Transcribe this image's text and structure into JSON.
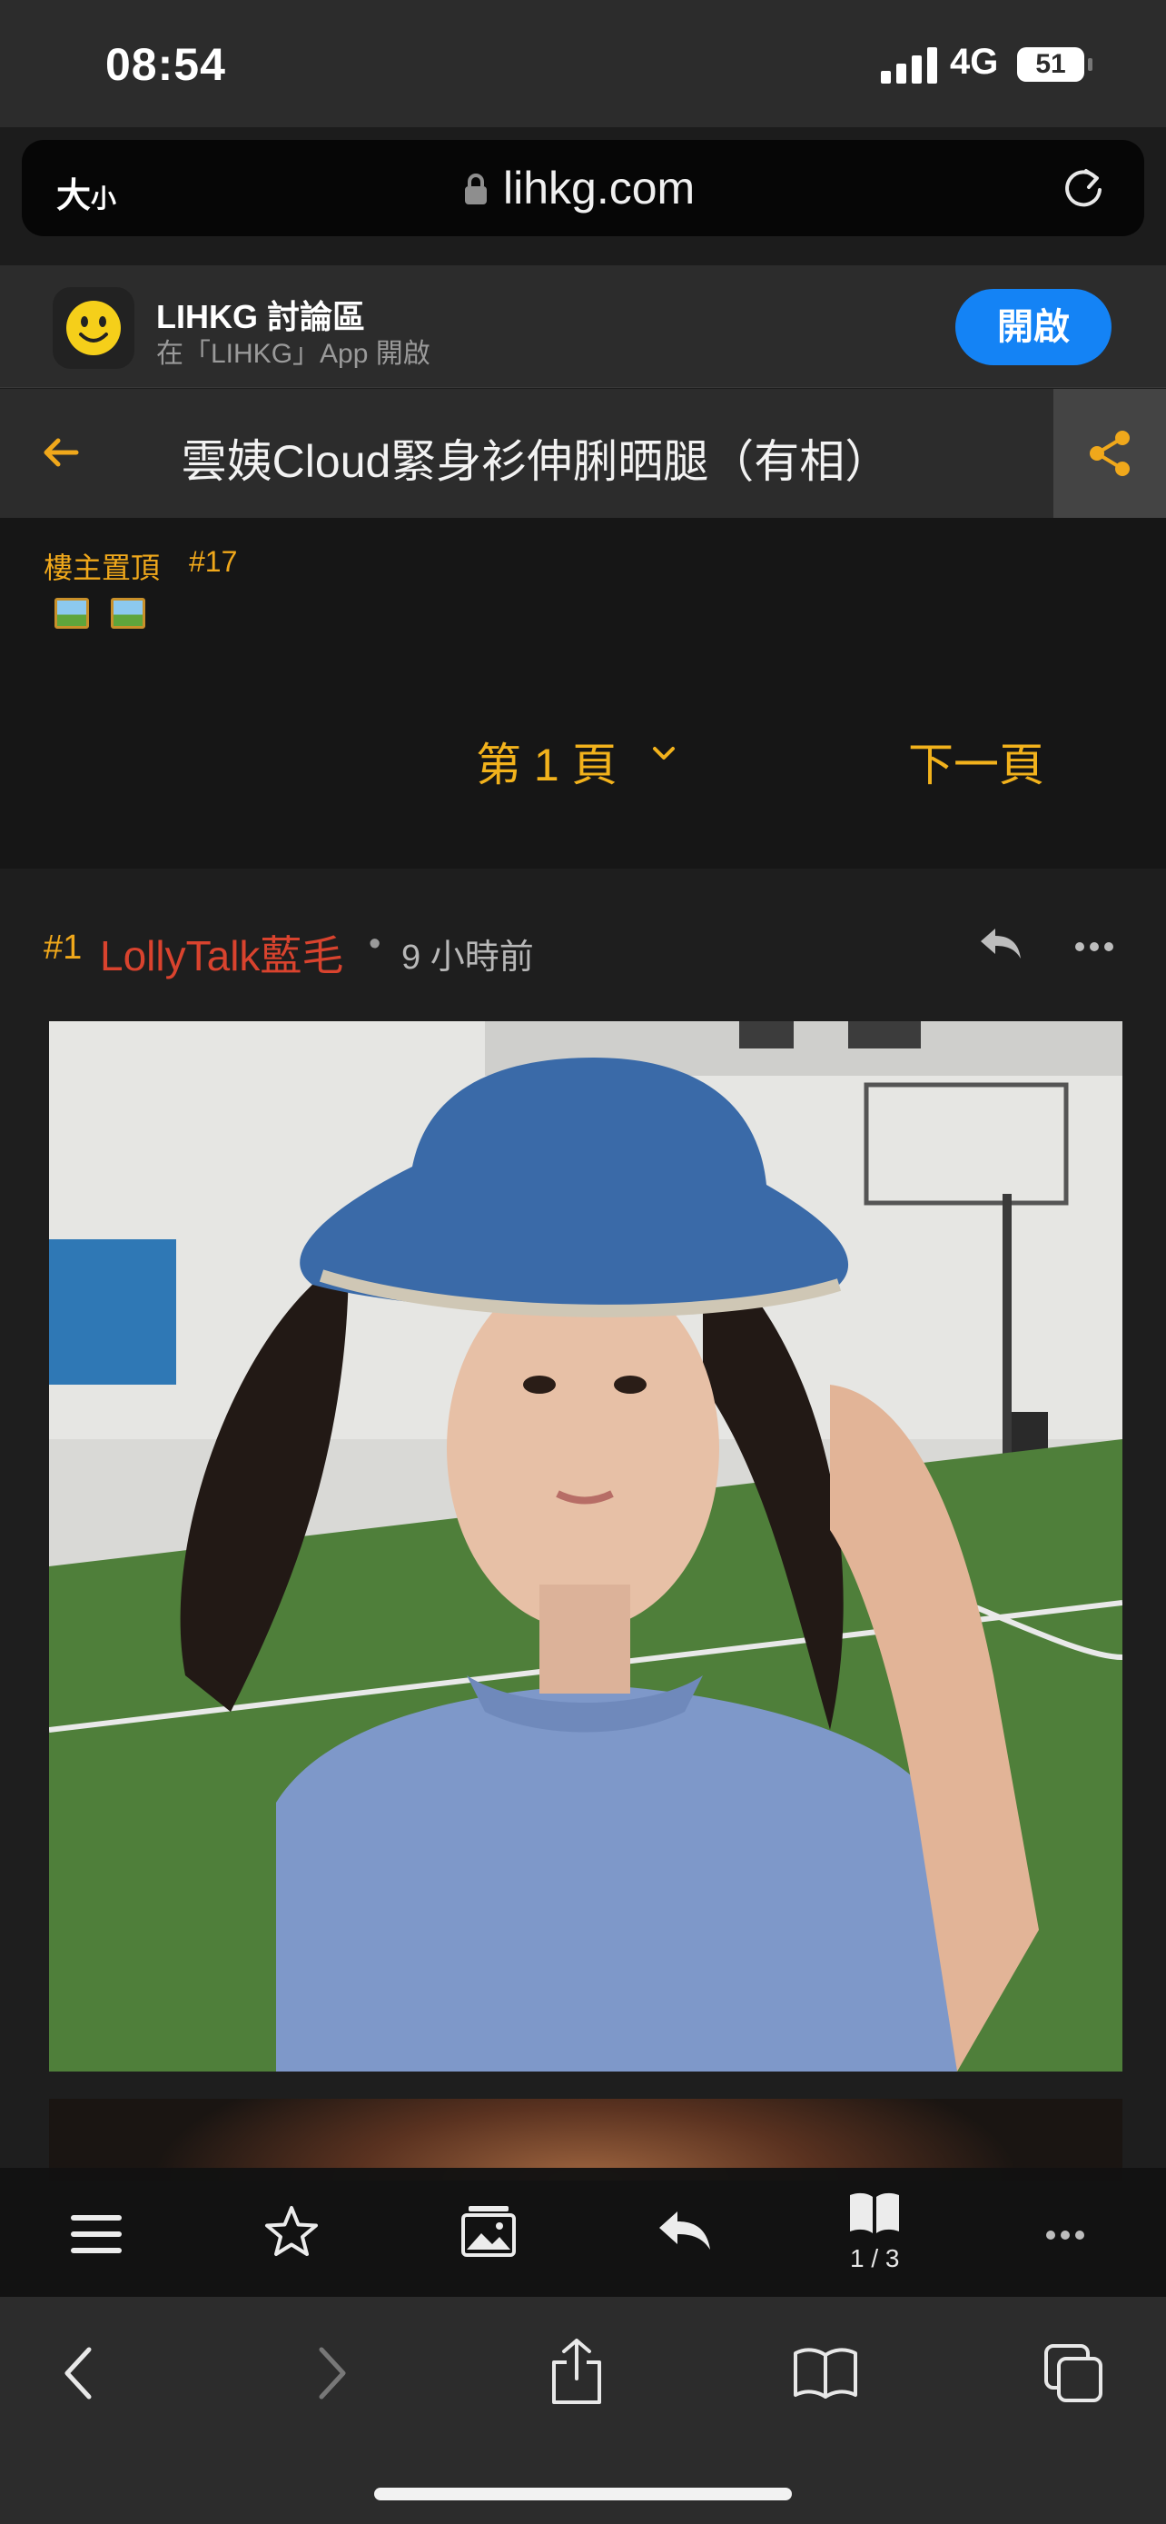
{
  "status_bar": {
    "time": "08:54",
    "network": "4G",
    "battery": "51"
  },
  "url_bar": {
    "text_size_label": "大",
    "text_size_label_small": "小",
    "domain": "lihkg.com"
  },
  "app_banner": {
    "name": "LIHKG 討論區",
    "subtitle": "在「LIHKG」App 開啟",
    "open_label": "開啟"
  },
  "thread": {
    "title": "雲姨Cloud緊身衫伸脷晒腿（有相）"
  },
  "pinned": {
    "label": "樓主置頂",
    "post_ref": "#17"
  },
  "pagination": {
    "current": "第 1 頁",
    "next": "下一頁"
  },
  "post": {
    "number": "#1",
    "username": "LollyTalk藍毛",
    "separator": "•",
    "time": "9 小時前"
  },
  "toolbar": {
    "page_count": "1 / 3"
  },
  "colors": {
    "accent": "#f0a81b",
    "username": "#d9432e",
    "open_button": "#1483f5"
  }
}
